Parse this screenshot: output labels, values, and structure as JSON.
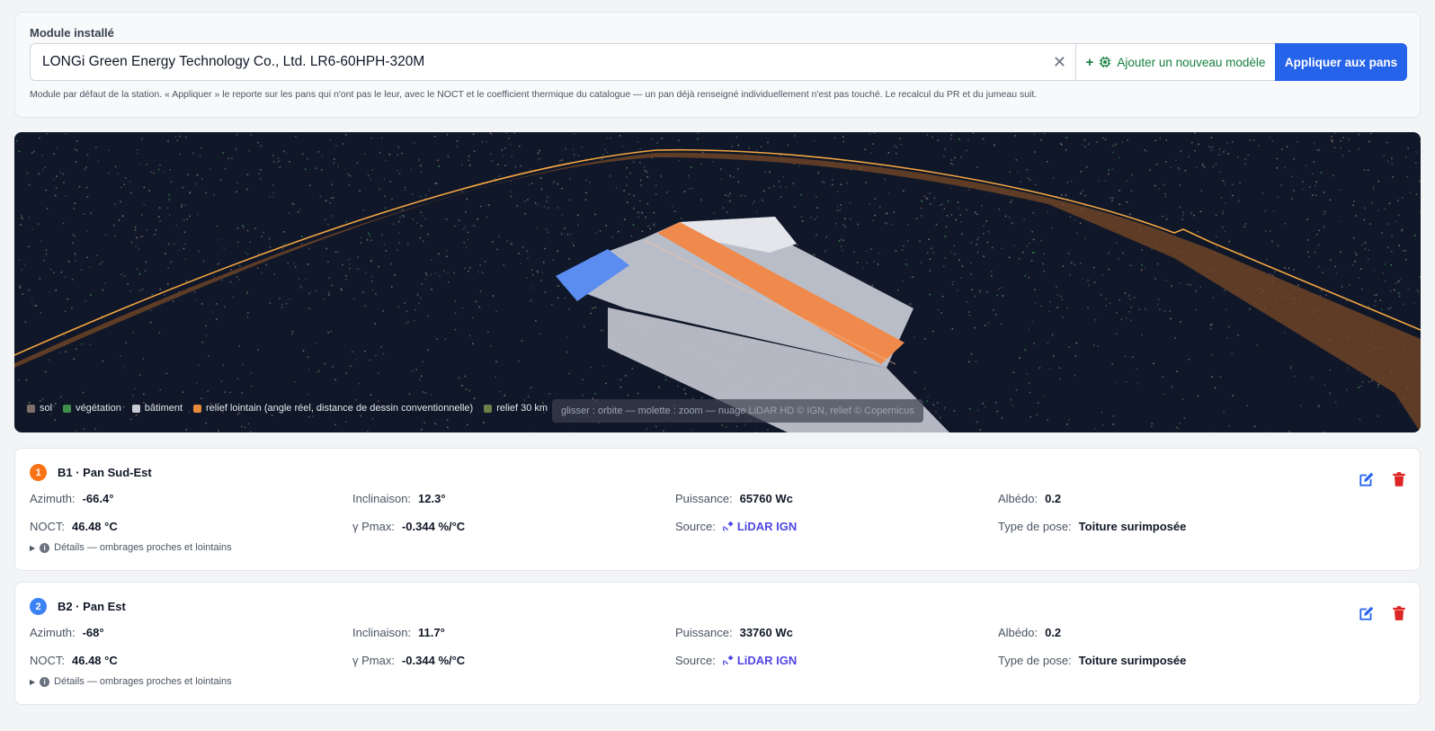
{
  "module": {
    "label": "Module installé",
    "value": "LONGi Green Energy Technology Co., Ltd. LR6-60HPH-320M",
    "clear_symbol": "✕",
    "add_label": "Ajouter un nouveau modèle",
    "apply_label": "Appliquer aux pans",
    "help": "Module par défaut de la station. « Appliquer » le reporte sur les pans qui n'ont pas le leur, avec le NOCT et le coefficient thermique du catalogue — un pan déjà renseigné individuellement n'est pas touché. Le recalcul du PR et du jumeau suit."
  },
  "viewer": {
    "legend": [
      {
        "label": "sol",
        "color": "#7c6f67"
      },
      {
        "label": "végétation",
        "color": "#3f8f4a"
      },
      {
        "label": "bâtiment",
        "color": "#c7cad3"
      },
      {
        "label": "relief lointain (angle réel, distance de dessin conventionnelle)",
        "color": "#e88b3a"
      },
      {
        "label": "relief 30 km",
        "color": "#6b7f4a"
      }
    ],
    "hint": "glisser : orbite — molette : zoom — nuage LiDAR HD © IGN, relief © Copernicus"
  },
  "pans": [
    {
      "number": "1",
      "badge_color": "#f97316",
      "title": "B1 · Pan Sud-Est",
      "azimuth_label": "Azimuth:",
      "azimuth": "-66.4°",
      "inclinaison_label": "Inclinaison:",
      "inclinaison": "12.3°",
      "puissance_label": "Puissance:",
      "puissance": "65760 Wc",
      "albedo_label": "Albédo:",
      "albedo": "0.2",
      "noct_label": "NOCT:",
      "noct": "46.48 °C",
      "gamma_label": "γ Pmax:",
      "gamma": "-0.344 %/°C",
      "source_label": "Source:",
      "source": "LiDAR IGN",
      "pose_label": "Type de pose:",
      "pose": "Toiture surimposée",
      "details": "Détails — ombrages proches et lointains"
    },
    {
      "number": "2",
      "badge_color": "#3b82f6",
      "title": "B2 · Pan Est",
      "azimuth_label": "Azimuth:",
      "azimuth": "-68°",
      "inclinaison_label": "Inclinaison:",
      "inclinaison": "11.7°",
      "puissance_label": "Puissance:",
      "puissance": "33760 Wc",
      "albedo_label": "Albédo:",
      "albedo": "0.2",
      "noct_label": "NOCT:",
      "noct": "46.48 °C",
      "gamma_label": "γ Pmax:",
      "gamma": "-0.344 %/°C",
      "source_label": "Source:",
      "source": "LiDAR IGN",
      "pose_label": "Type de pose:",
      "pose": "Toiture surimposée",
      "details": "Détails — ombrages proches et lointains"
    }
  ]
}
